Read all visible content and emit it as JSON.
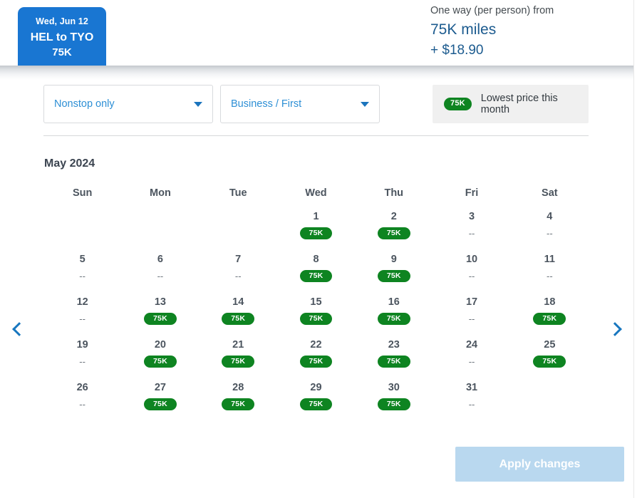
{
  "header": {
    "flight_tab": {
      "date": "Wed, Jun 12",
      "route": "HEL to TYO",
      "price": "75K"
    },
    "price_summary": {
      "label": "One way (per person) from",
      "miles": "75K miles",
      "fee": "+ $18.90"
    }
  },
  "filters": {
    "stops_select": {
      "value": "Nonstop only",
      "icon": "chevron-down-icon"
    },
    "cabin_select": {
      "value": "Business / First",
      "icon": "chevron-down-icon"
    },
    "legend": {
      "pill": "75K",
      "text": "Lowest price this month"
    }
  },
  "calendar": {
    "month_title": "May 2024",
    "weekday_headers": [
      "Sun",
      "Mon",
      "Tue",
      "Wed",
      "Thu",
      "Fri",
      "Sat"
    ],
    "no_price_marker": "--",
    "prev_label": "chevron-left-icon",
    "next_label": "chevron-right-icon",
    "weeks": [
      [
        {
          "day": "",
          "price": ""
        },
        {
          "day": "",
          "price": ""
        },
        {
          "day": "",
          "price": ""
        },
        {
          "day": "1",
          "price": "75K"
        },
        {
          "day": "2",
          "price": "75K"
        },
        {
          "day": "3",
          "price": "--"
        },
        {
          "day": "4",
          "price": "--"
        }
      ],
      [
        {
          "day": "5",
          "price": "--"
        },
        {
          "day": "6",
          "price": "--"
        },
        {
          "day": "7",
          "price": "--"
        },
        {
          "day": "8",
          "price": "75K"
        },
        {
          "day": "9",
          "price": "75K"
        },
        {
          "day": "10",
          "price": "--"
        },
        {
          "day": "11",
          "price": "--"
        }
      ],
      [
        {
          "day": "12",
          "price": "--"
        },
        {
          "day": "13",
          "price": "75K"
        },
        {
          "day": "14",
          "price": "75K"
        },
        {
          "day": "15",
          "price": "75K"
        },
        {
          "day": "16",
          "price": "75K"
        },
        {
          "day": "17",
          "price": "--"
        },
        {
          "day": "18",
          "price": "75K"
        }
      ],
      [
        {
          "day": "19",
          "price": "--"
        },
        {
          "day": "20",
          "price": "75K"
        },
        {
          "day": "21",
          "price": "75K"
        },
        {
          "day": "22",
          "price": "75K"
        },
        {
          "day": "23",
          "price": "75K"
        },
        {
          "day": "24",
          "price": "--"
        },
        {
          "day": "25",
          "price": "75K"
        }
      ],
      [
        {
          "day": "26",
          "price": "--"
        },
        {
          "day": "27",
          "price": "75K"
        },
        {
          "day": "28",
          "price": "75K"
        },
        {
          "day": "29",
          "price": "75K"
        },
        {
          "day": "30",
          "price": "75K"
        },
        {
          "day": "31",
          "price": "--"
        },
        {
          "day": "",
          "price": ""
        }
      ]
    ]
  },
  "footer": {
    "apply_label": "Apply changes"
  },
  "colors": {
    "brand_blue": "#1976d2",
    "link_blue": "#2d8fd5",
    "price_green": "#0e8421",
    "disabled_button": "#b9d8ef",
    "heading_gray": "#4c555f"
  }
}
